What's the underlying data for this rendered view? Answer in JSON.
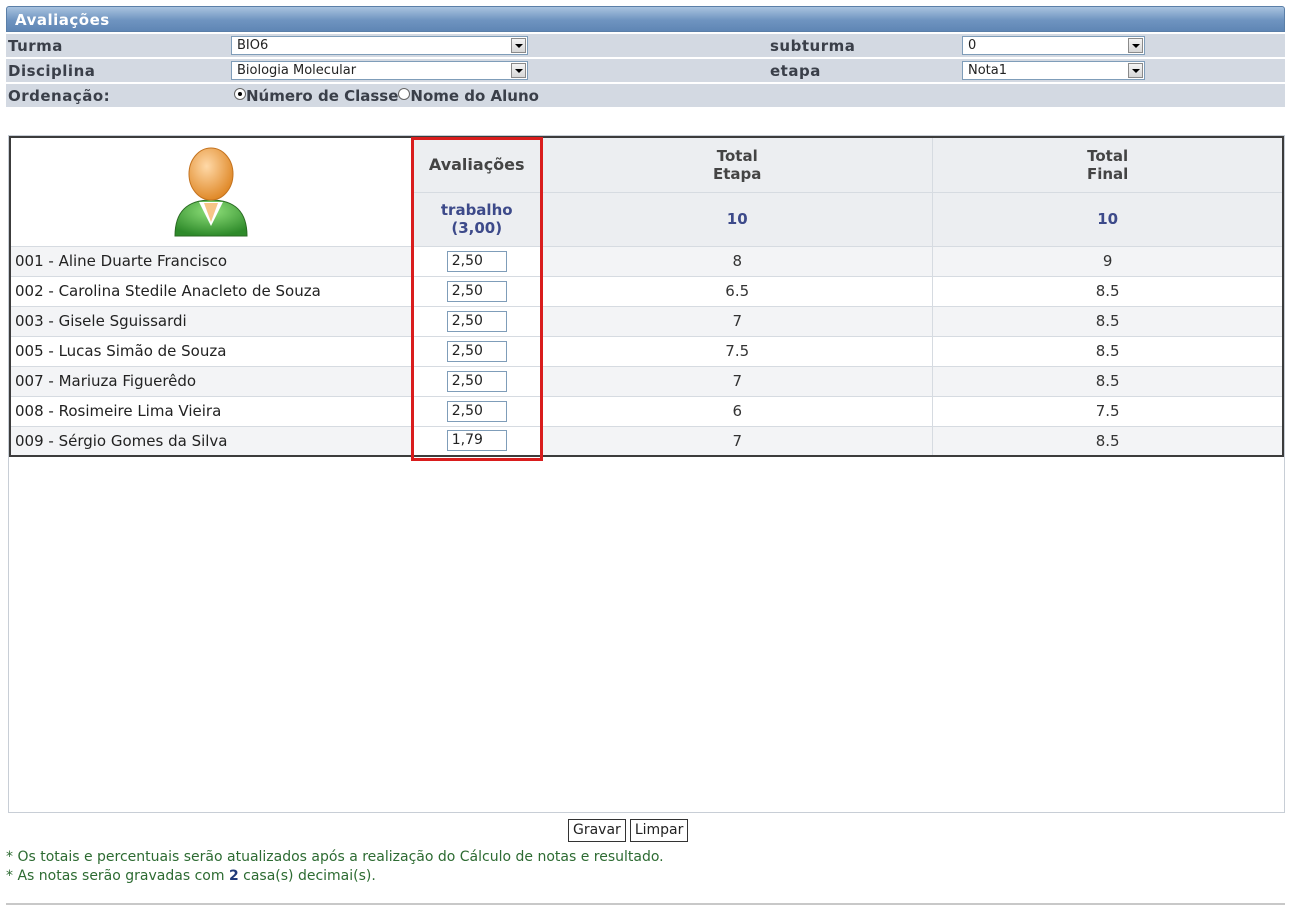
{
  "header": {
    "title": "Avaliações"
  },
  "filters": {
    "turma_label": "Turma",
    "turma_value": "BIO6",
    "subturma_label": "subturma",
    "subturma_value": "0",
    "disciplina_label": "Disciplina",
    "disciplina_value": "Biologia Molecular",
    "etapa_label": "etapa",
    "etapa_value": "Nota1",
    "ordenacao_label": "Ordenação:",
    "radio1": "Número de Classe",
    "radio2": "Nome do Aluno"
  },
  "table": {
    "avaliacoes_header": "Avaliações",
    "total_etapa_1": "Total",
    "total_etapa_2": "Etapa",
    "total_final_1": "Total",
    "total_final_2": "Final",
    "trabalho_1": "trabalho",
    "trabalho_2": "(3,00)",
    "etapa_max": "10",
    "final_max": "10",
    "rows": [
      {
        "name": "001 - Aline Duarte Francisco",
        "grade": "2,50",
        "etapa": "8",
        "final": "9"
      },
      {
        "name": "002 - Carolina Stedile Anacleto de Souza",
        "grade": "2,50",
        "etapa": "6.5",
        "final": "8.5"
      },
      {
        "name": "003 - Gisele Sguissardi",
        "grade": "2,50",
        "etapa": "7",
        "final": "8.5"
      },
      {
        "name": "005 - Lucas Simão de Souza",
        "grade": "2,50",
        "etapa": "7.5",
        "final": "8.5"
      },
      {
        "name": "007 - Mariuza Figuerêdo",
        "grade": "2,50",
        "etapa": "7",
        "final": "8.5"
      },
      {
        "name": "008 - Rosimeire Lima Vieira",
        "grade": "2,50",
        "etapa": "6",
        "final": "7.5"
      },
      {
        "name": "009 - Sérgio Gomes da Silva",
        "grade": "1,79",
        "etapa": "7",
        "final": "8.5"
      }
    ]
  },
  "actions": {
    "save": "Gravar",
    "clear": "Limpar"
  },
  "notes": {
    "line1": "* Os totais e percentuais serão atualizados após a realização do Cálculo de notas e resultado.",
    "line2_a": "* As notas serão gravadas com ",
    "line2_b": "2",
    "line2_c": " casa(s) decimai(s)."
  }
}
